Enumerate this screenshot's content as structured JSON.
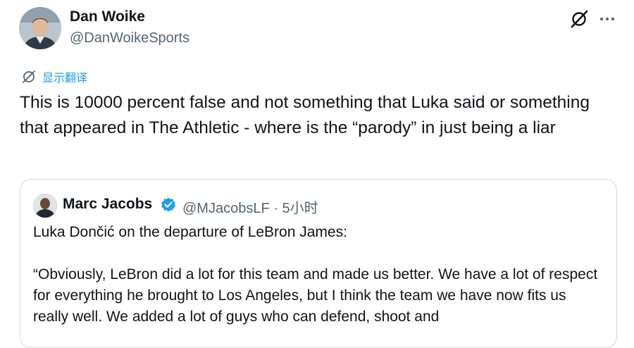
{
  "tweet": {
    "author_name": "Dan Woike",
    "author_handle": "@DanWoikeSports",
    "translate_label": "显示翻译",
    "text": "This is 10000 percent false and not something that Luka said or something that appeared in The Athletic - where is the “parody” in just being a liar",
    "icons": {
      "grok": "grok-icon",
      "more": "more-icon",
      "translate": "translate-icon"
    }
  },
  "quoted": {
    "author_name": "Marc Jacobs",
    "author_handle": "@MJacobsLF",
    "separator": "·",
    "time": "5小时",
    "verified": true,
    "text_paragraphs": [
      "Luka Dončić on the departure of LeBron James:",
      "“Obviously, LeBron did a lot for this team and made us better. We have a lot of respect for everything he brought to Los Angeles, but I think the team we have now fits us really well. We added a lot of guys who can defend, shoot and"
    ]
  },
  "colors": {
    "text_primary": "#0f1419",
    "text_secondary": "#536471",
    "link_blue": "#1d9bf0",
    "border": "#cfd9de",
    "verified_blue": "#1d9bf0"
  }
}
